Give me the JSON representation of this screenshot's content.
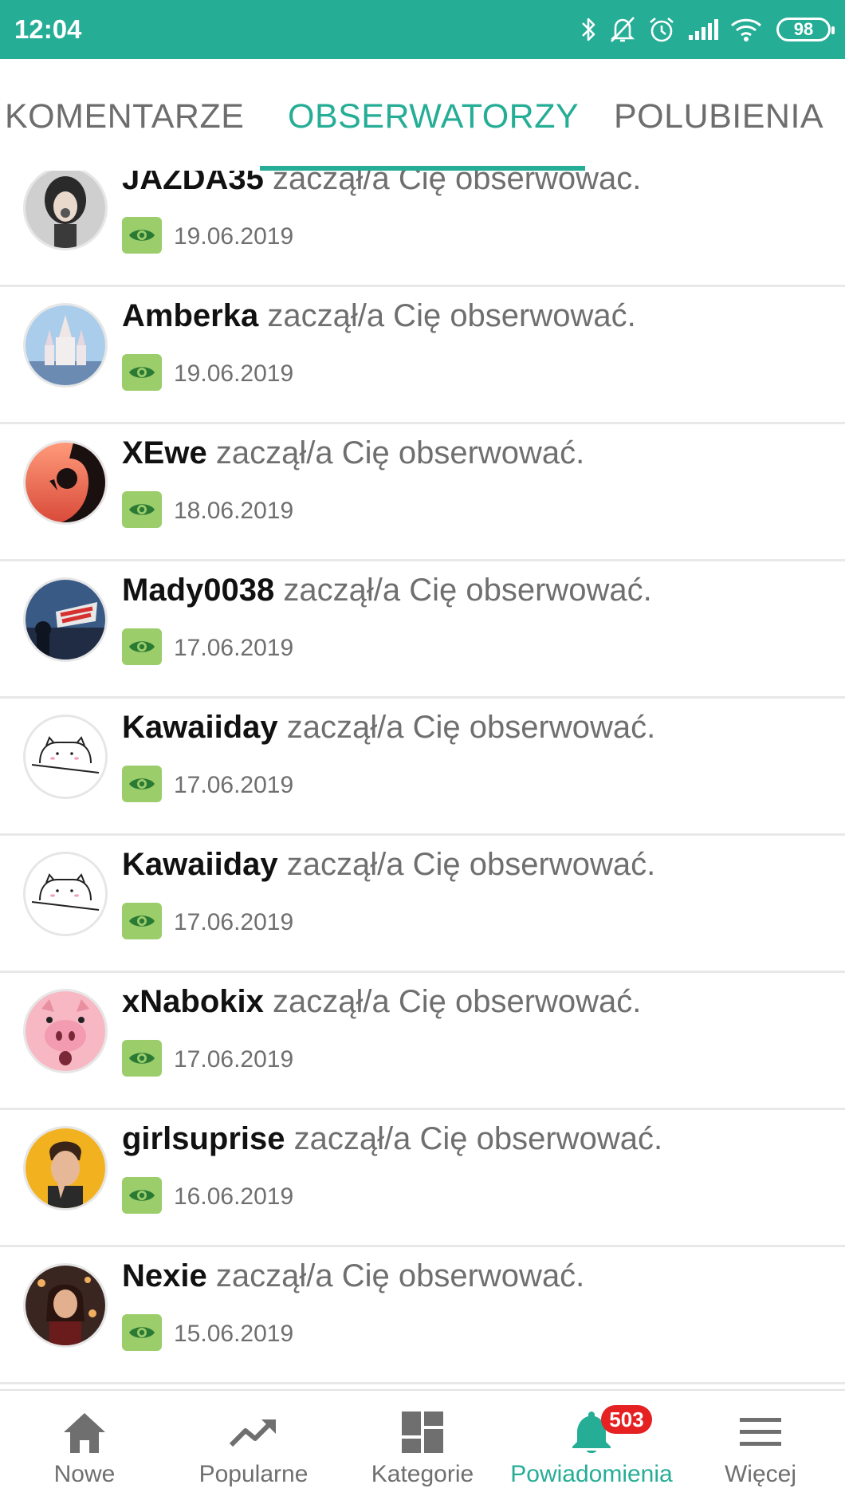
{
  "status_bar": {
    "time": "12:04",
    "battery": "98",
    "icons": [
      "bluetooth-icon",
      "notifications-off-icon",
      "alarm-icon",
      "signal-icon",
      "wifi-icon",
      "battery-icon"
    ]
  },
  "tabs": [
    {
      "label": "KOMENTARZE",
      "active": false
    },
    {
      "label": "OBSERWATORZY",
      "active": true
    },
    {
      "label": "POLUBIENIA",
      "active": false
    }
  ],
  "colors": {
    "accent": "#25ad96",
    "badge": "#e52121",
    "eye_badge": "#9ccd6b"
  },
  "notifications": [
    {
      "username": "JAZDA35",
      "message": "zaczął/a Cię obserwować.",
      "date": "19.06.2019"
    },
    {
      "username": "Amberka",
      "message": "zaczął/a Cię obserwować.",
      "date": "19.06.2019"
    },
    {
      "username": "XEwe",
      "message": "zaczął/a Cię obserwować.",
      "date": "18.06.2019"
    },
    {
      "username": "Mady0038",
      "message": "zaczął/a Cię obserwować.",
      "date": "17.06.2019"
    },
    {
      "username": "Kawaiiday",
      "message": "zaczął/a Cię obserwować.",
      "date": "17.06.2019"
    },
    {
      "username": "Kawaiiday",
      "message": "zaczął/a Cię obserwować.",
      "date": "17.06.2019"
    },
    {
      "username": "xNabokix",
      "message": "zaczął/a Cię obserwować.",
      "date": "17.06.2019"
    },
    {
      "username": "girlsuprise",
      "message": "zaczął/a Cię obserwować.",
      "date": "16.06.2019"
    },
    {
      "username": "Nexie",
      "message": "zaczął/a Cię obserwować.",
      "date": "15.06.2019"
    }
  ],
  "bottom_nav": [
    {
      "label": "Nowe",
      "icon": "home-icon",
      "active": false
    },
    {
      "label": "Popularne",
      "icon": "trending-icon",
      "active": false
    },
    {
      "label": "Kategorie",
      "icon": "categories-icon",
      "active": false
    },
    {
      "label": "Powiadomienia",
      "icon": "bell-icon",
      "active": true,
      "badge": "503"
    },
    {
      "label": "Więcej",
      "icon": "menu-icon",
      "active": false
    }
  ]
}
